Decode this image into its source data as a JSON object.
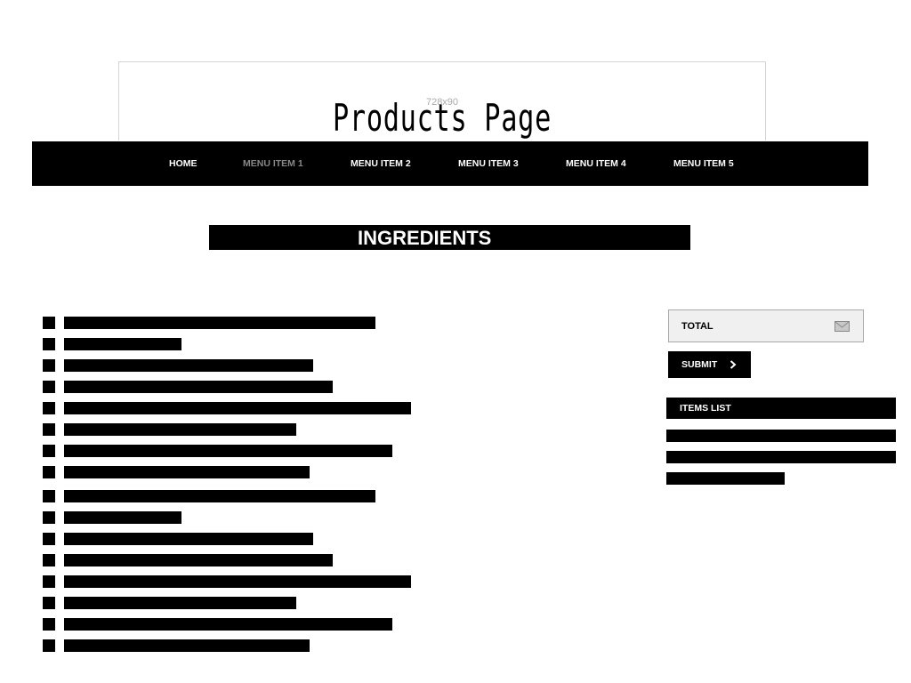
{
  "banner": {
    "size_label": "728x90",
    "title": "Products Page"
  },
  "nav": {
    "items": [
      {
        "label": "HOME",
        "active": false
      },
      {
        "label": "MENU ITEM 1",
        "active": true
      },
      {
        "label": "MENU ITEM 2",
        "active": false
      },
      {
        "label": "MENU ITEM 3",
        "active": false
      },
      {
        "label": "MENU ITEM 4",
        "active": false
      },
      {
        "label": "MENU ITEM 5",
        "active": false
      }
    ]
  },
  "section": {
    "heading": "INGREDIENTS"
  },
  "sidebar": {
    "total_label": "TOTAL",
    "submit_label": "SUBMIT",
    "items_list_label": "ITEMS LIST"
  },
  "icons": {
    "total": "mail-icon",
    "submit": "chevron-right-icon"
  },
  "colors": {
    "bar": "#000000",
    "nav_background": "#000000",
    "nav_text": "#ffffff",
    "nav_active_text": "#888888",
    "total_background": "#f0f0f0"
  }
}
